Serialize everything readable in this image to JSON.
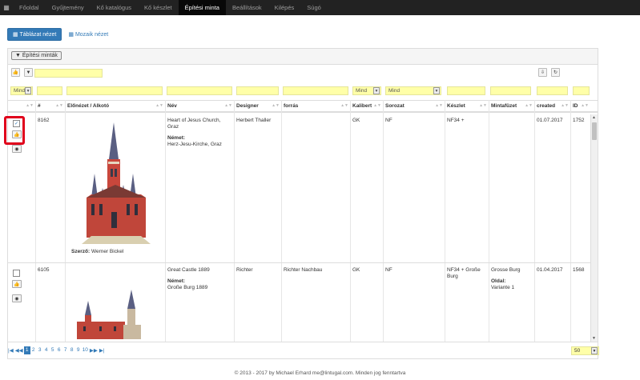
{
  "nav": {
    "items": [
      "Főoldal",
      "Gyűjtemény",
      "Kő katalógus",
      "Kő készlet",
      "Építési minta",
      "Beállítások",
      "Kilépés",
      "Súgó"
    ],
    "active_index": 4
  },
  "view": {
    "table_btn": "Táblázat nézet",
    "mosaic_link": "Mozaik nézet"
  },
  "panel": {
    "title_btn": "Építési minták"
  },
  "filters": {
    "mind1": "Mind",
    "mind2": "Mind",
    "mind3": "Mind"
  },
  "columns": [
    "#",
    "Előnézet / Alkotó",
    "Név",
    "Designer",
    "forrás",
    "Kalibert",
    "Sorozat",
    "Készlet",
    "Mintafüzet",
    "created",
    "ID"
  ],
  "rows": [
    {
      "num": "8162",
      "author_label": "Szerző:",
      "author": "Werner Bickel",
      "name": "Heart of Jesus Church, Graz",
      "name_sub_label": "Német:",
      "name_sub": "Herz-Jesu-Kirche, Graz",
      "designer": "Herbert Thaller",
      "source": "",
      "caliber": "GK",
      "series": "NF",
      "kit": "NF34 +",
      "booklet": "",
      "booklet_sub_label": "",
      "booklet_sub": "",
      "created": "01.07.2017",
      "id": "1752",
      "checked": true
    },
    {
      "num": "6105",
      "author_label": "",
      "author": "",
      "name": "Great Castle 1889",
      "name_sub_label": "Német:",
      "name_sub": "Große Burg 1889",
      "designer": "Richter",
      "source": "Richter Nachbau",
      "caliber": "GK",
      "series": "NF",
      "kit": "NF34 + Große Burg",
      "booklet": "Grosse Burg",
      "booklet_sub_label": "Oldal:",
      "booklet_sub": "Variante 1",
      "created": "01.04.2017",
      "id": "1568",
      "checked": false
    }
  ],
  "pager": {
    "pages": [
      "1",
      "2",
      "3",
      "4",
      "5",
      "6",
      "7",
      "8",
      "9",
      "10"
    ],
    "active": "1",
    "page_size": "50"
  },
  "footer": "© 2013 - 2017 by Michael Erhard me@lintugal.com. Minden jog fenntartva",
  "colors": {
    "nav_bg": "#222222",
    "primary": "#337ab7",
    "filter_yellow": "#ffffa8",
    "highlight_red": "#e0001b"
  }
}
